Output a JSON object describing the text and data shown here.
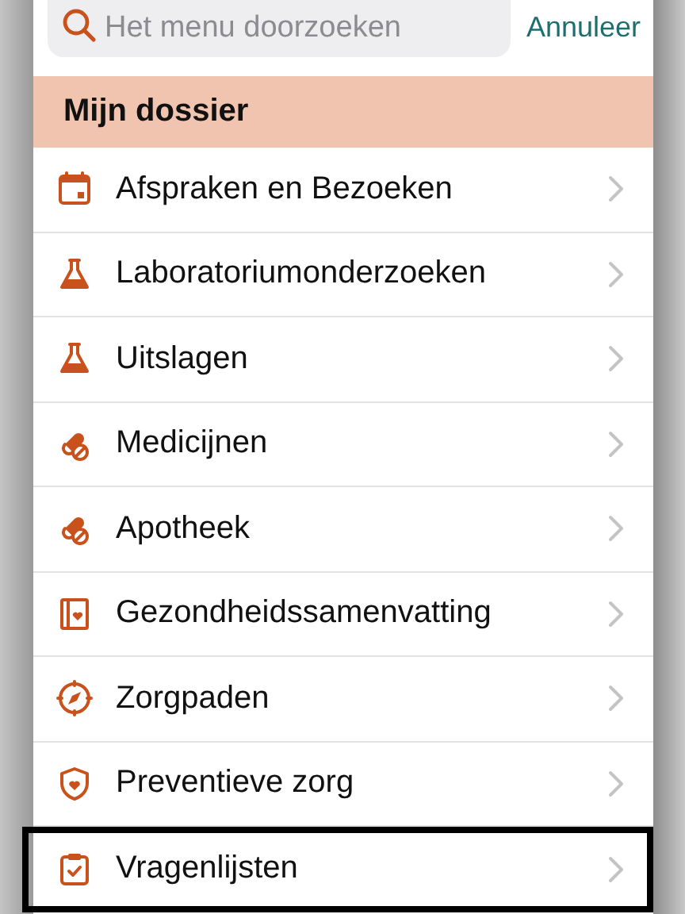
{
  "search": {
    "placeholder": "Het menu doorzoeken",
    "cancel": "Annuleer"
  },
  "section": {
    "title": "Mijn dossier"
  },
  "items": [
    {
      "label": "Afspraken en Bezoeken",
      "selected": false
    },
    {
      "label": "Laboratoriumonderzoeken",
      "selected": false
    },
    {
      "label": "Uitslagen",
      "selected": false
    },
    {
      "label": "Medicijnen",
      "selected": false
    },
    {
      "label": "Apotheek",
      "selected": false
    },
    {
      "label": "Gezondheidssamenvatting",
      "selected": false
    },
    {
      "label": "Zorgpaden",
      "selected": false
    },
    {
      "label": "Preventieve zorg",
      "selected": false
    },
    {
      "label": "Vragenlijsten",
      "selected": true
    }
  ]
}
